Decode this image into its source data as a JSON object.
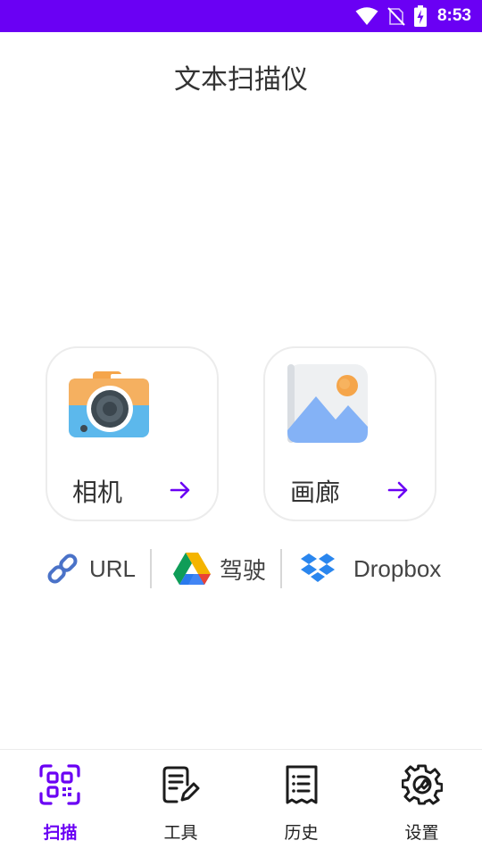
{
  "status_bar": {
    "time": "8:53",
    "background": "#6a00f4"
  },
  "app": {
    "title": "文本扫描仪"
  },
  "cards": [
    {
      "label": "相机",
      "icon": "camera-icon"
    },
    {
      "label": "画廊",
      "icon": "gallery-icon"
    }
  ],
  "sources": [
    {
      "label": "URL",
      "icon": "link-icon"
    },
    {
      "label": "驾驶",
      "icon": "google-drive-icon"
    },
    {
      "label": "Dropbox",
      "icon": "dropbox-icon"
    }
  ],
  "nav": [
    {
      "label": "扫描",
      "icon": "qr-scan-icon",
      "active": true
    },
    {
      "label": "工具",
      "icon": "tools-icon"
    },
    {
      "label": "历史",
      "icon": "history-icon"
    },
    {
      "label": "设置",
      "icon": "settings-icon"
    }
  ],
  "colors": {
    "accent": "#6a00f4",
    "text": "#333333",
    "border": "#ececec"
  }
}
